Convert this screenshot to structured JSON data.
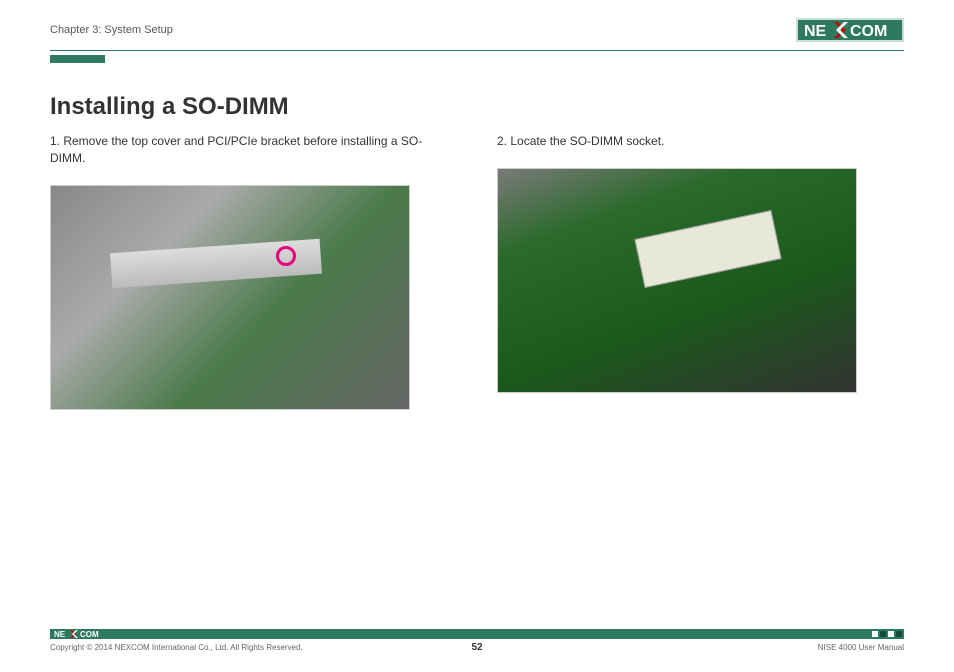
{
  "header": {
    "chapter": "Chapter 3: System Setup",
    "logo_text_left": "NE",
    "logo_text_right": "COM"
  },
  "content": {
    "title": "Installing a SO-DIMM",
    "steps": [
      "1. Remove the top cover and PCI/PCIe bracket before installing a SO-DIMM.",
      "2. Locate the SO-DIMM socket."
    ]
  },
  "footer": {
    "logo_text_left": "NE",
    "logo_text_right": "COM",
    "copyright": "Copyright © 2014 NEXCOM International Co., Ltd. All Rights Reserved.",
    "page_number": "52",
    "manual": "NISE 4000 User Manual"
  }
}
